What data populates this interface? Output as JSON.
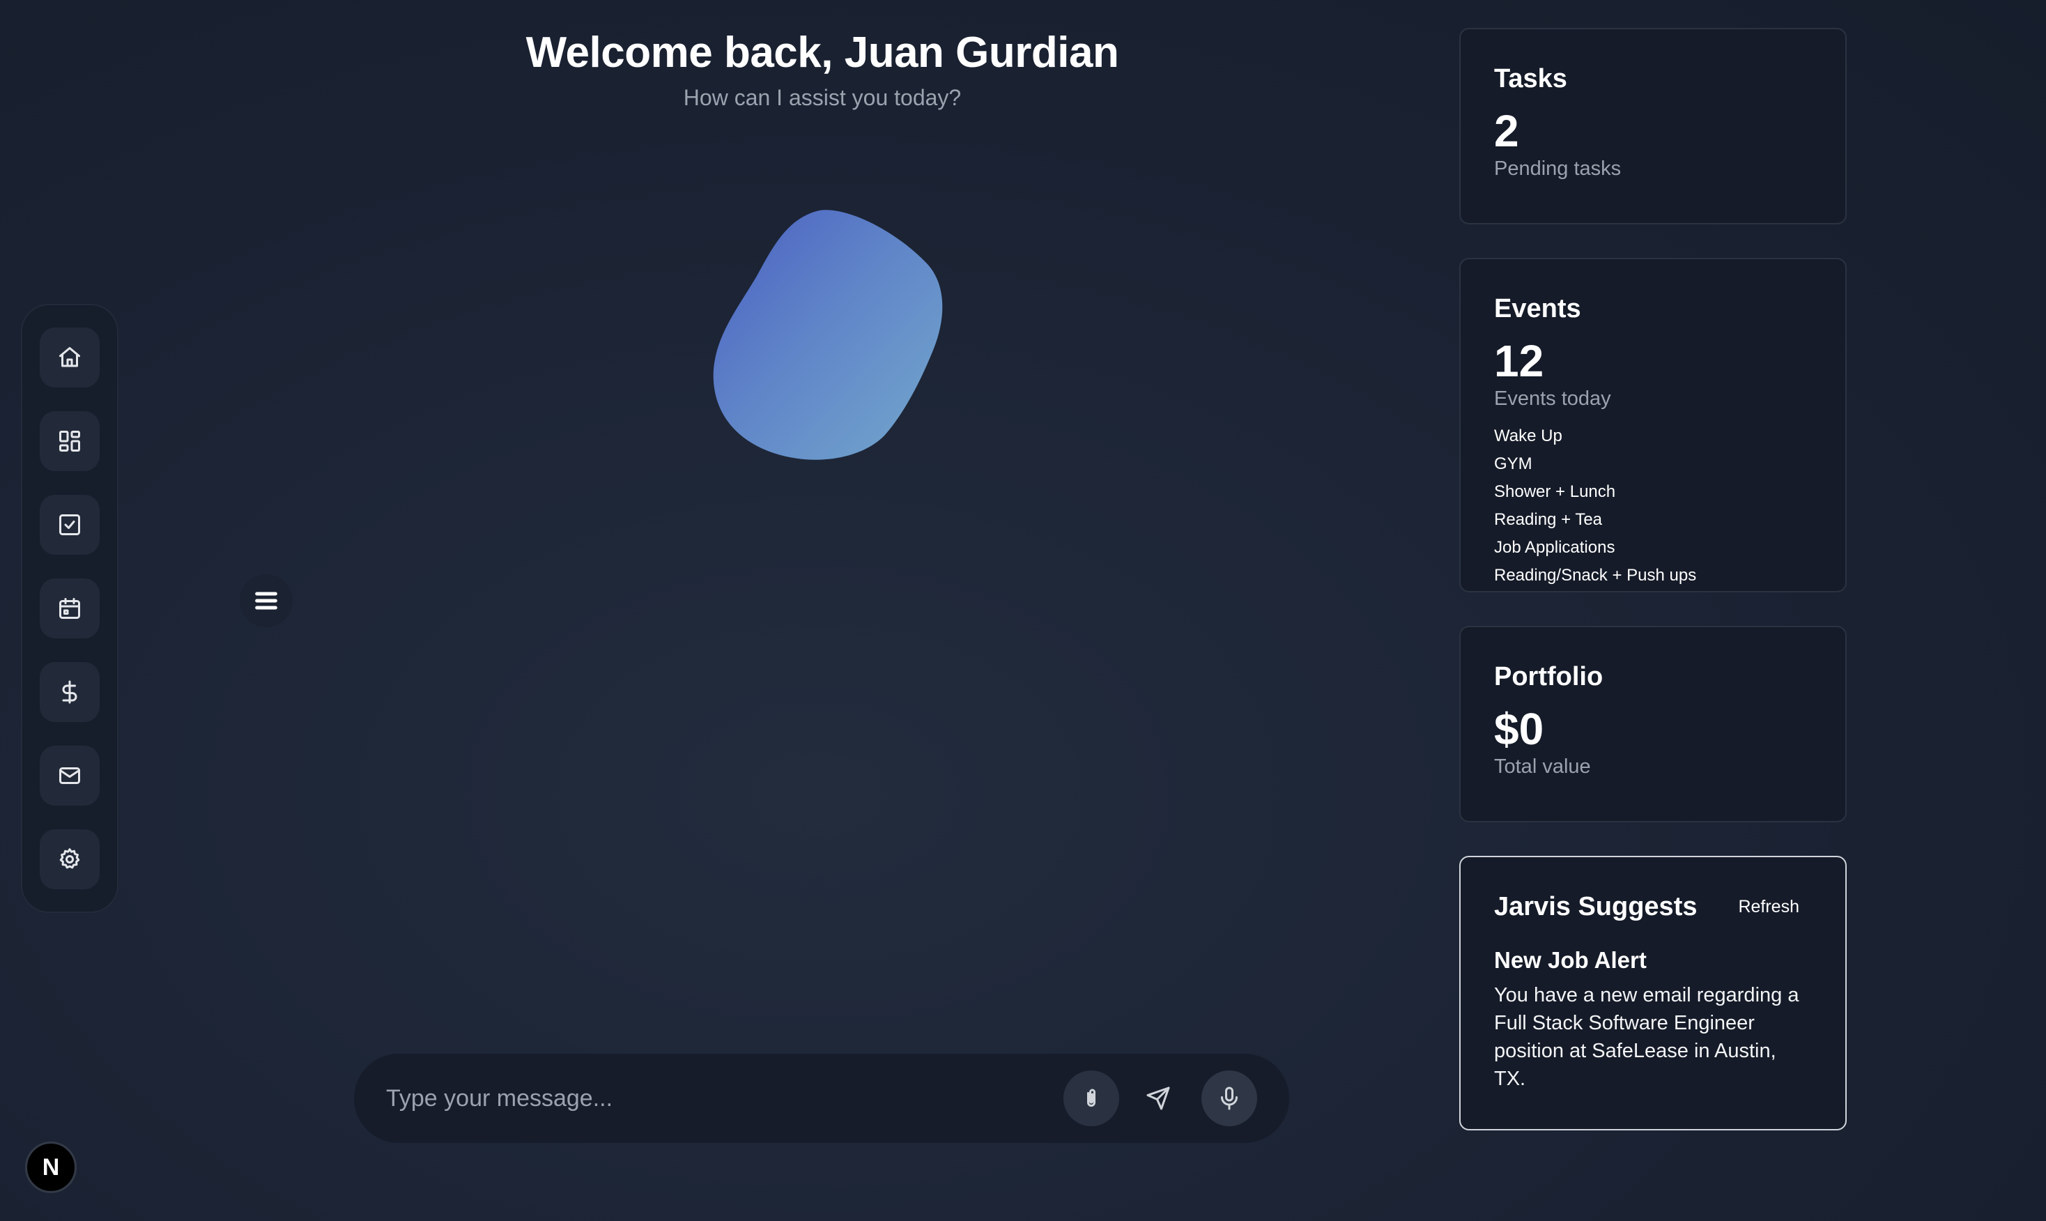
{
  "header": {
    "title": "Welcome back, Juan Gurdian",
    "subtitle": "How can I assist you today?"
  },
  "sidebar": {
    "items": [
      {
        "name": "home",
        "icon": "home-icon"
      },
      {
        "name": "dashboard",
        "icon": "dashboard-icon"
      },
      {
        "name": "tasks",
        "icon": "checkbox-icon"
      },
      {
        "name": "calendar",
        "icon": "calendar-icon"
      },
      {
        "name": "finance",
        "icon": "dollar-icon"
      },
      {
        "name": "mail",
        "icon": "mail-icon"
      },
      {
        "name": "settings",
        "icon": "gear-icon"
      }
    ]
  },
  "badge": {
    "letter": "N"
  },
  "chat": {
    "placeholder": "Type your message...",
    "icons": [
      "paperclip-icon",
      "send-icon",
      "microphone-icon"
    ]
  },
  "cards": {
    "tasks": {
      "title": "Tasks",
      "value": "2",
      "caption": "Pending tasks"
    },
    "events": {
      "title": "Events",
      "value": "12",
      "caption": "Events today",
      "items": [
        "Wake Up",
        "GYM",
        "Shower + Lunch",
        "Reading + Tea",
        "Job Applications",
        "Reading/Snack + Push ups"
      ]
    },
    "portfolio": {
      "title": "Portfolio",
      "value": "$0",
      "caption": "Total value"
    },
    "suggest": {
      "title": "Jarvis Suggests",
      "refresh_label": "Refresh",
      "alert_title": "New Job Alert",
      "alert_body": "You have a new email regarding a Full Stack Software Engineer position at SafeLease in Austin, TX."
    }
  },
  "colors": {
    "background": "#1c2435",
    "card_bg": "#151b28",
    "orb_start": "#4a5fc1",
    "orb_end": "#6fa0cf"
  }
}
